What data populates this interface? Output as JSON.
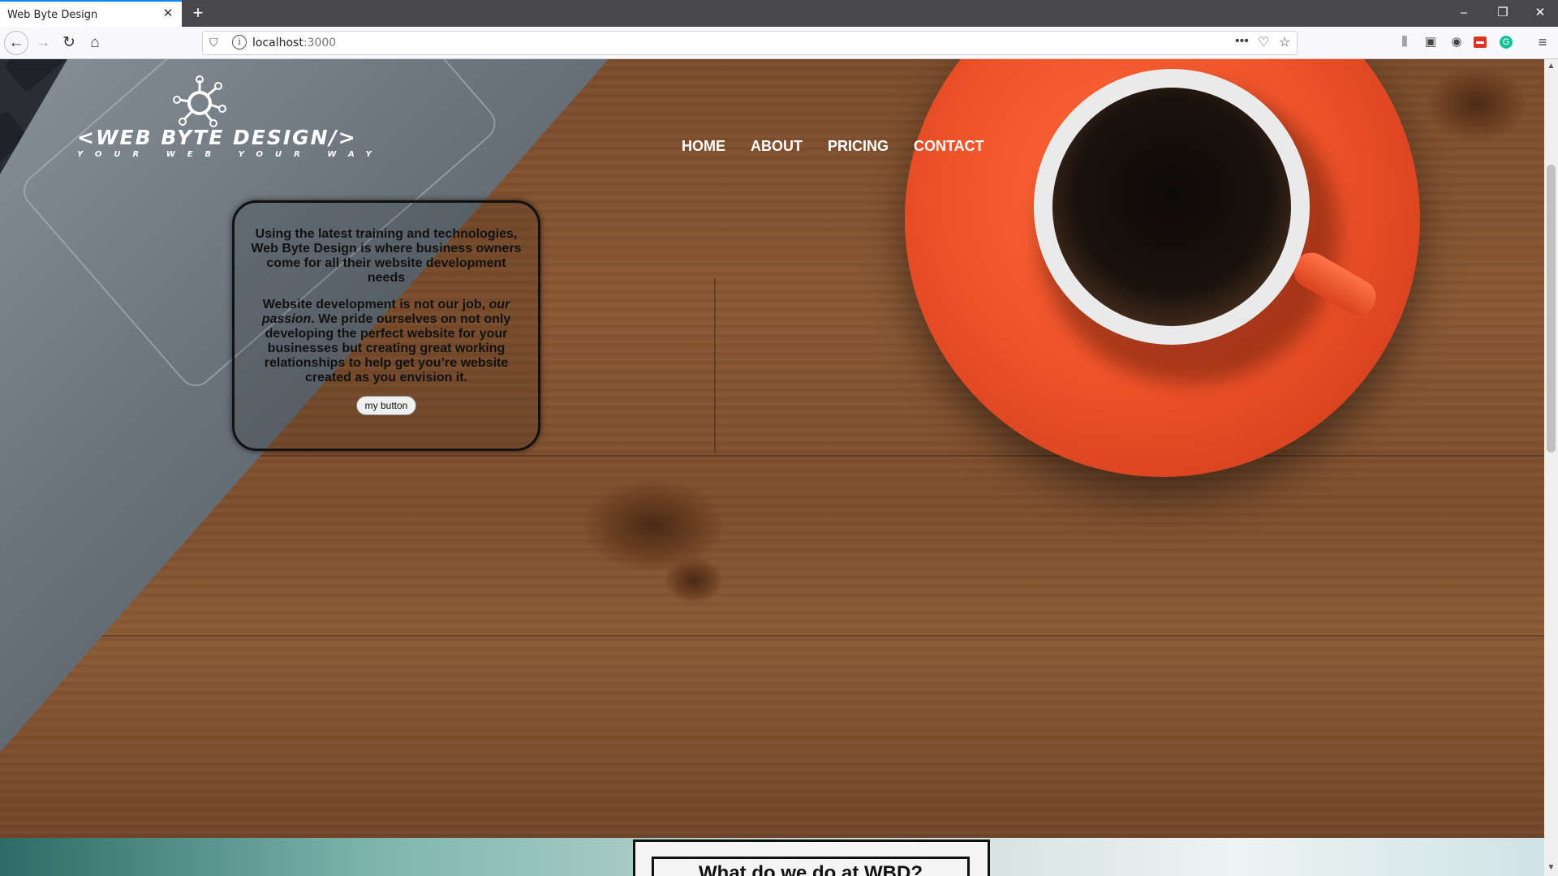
{
  "browser": {
    "tab_title": "Web Byte Design",
    "tab_close": "✕",
    "new_tab": "+",
    "url_host": "localhost",
    "url_port": ":3000",
    "window_controls": [
      "–",
      "❐",
      "✕"
    ]
  },
  "site": {
    "logo_text": "<WEB BYTE DESIGN/>",
    "logo_tagline": "YOUR WEB YOUR WAY",
    "nav": [
      "HOME",
      "ABOUT",
      "PRICING",
      "CONTACT"
    ],
    "intro_p1": "Using the latest training and technologies, Web Byte Design is where business owners come for all their website development needs",
    "intro_p2_a": "Website development is not our job, ",
    "intro_p2_em": "our passion",
    "intro_p2_b": ". We pride ourselves on not only developing the perfect website for your businesses but creating great working relationships to help get you’re website created as you envision it.",
    "button_label": "my button",
    "section2_title": "What do we do at WBD?"
  }
}
